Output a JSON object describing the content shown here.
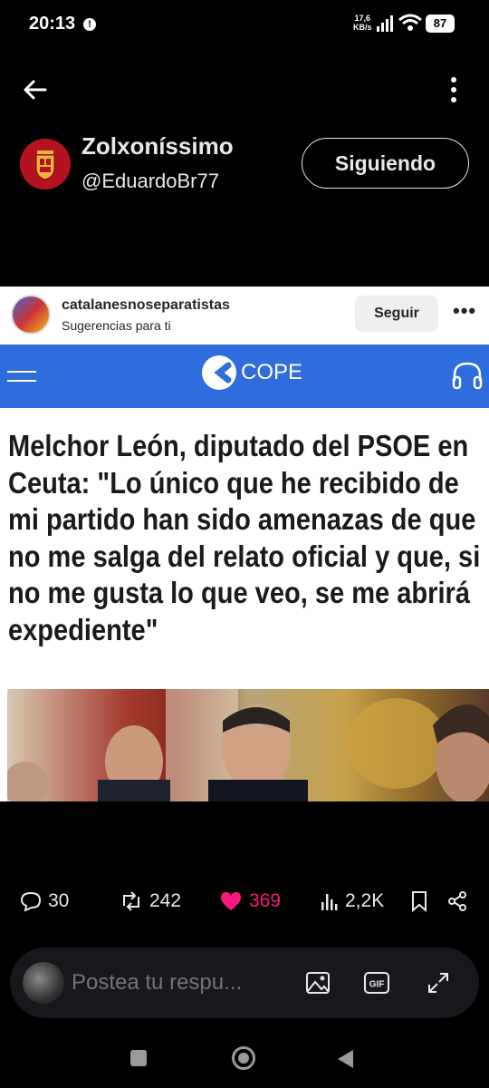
{
  "status_bar": {
    "time": "20:13",
    "alert_icon": "!",
    "speed_value": "17,6",
    "speed_unit": "KB/s",
    "battery": "87"
  },
  "header": {
    "display_name": "Zolxoníssimo",
    "handle": "@EduardoBr77",
    "follow_label": "Siguiendo"
  },
  "embedded_card": {
    "username": "catalanesnoseparatistas",
    "subtitle": "Sugerencias para ti",
    "follow_label": "Seguir",
    "more_label": "•••",
    "brand": "COPE",
    "brand_color": "#2f6cdc",
    "headline": "Melchor León, diputado del PSOE en Ceuta: \"Lo único que he recibido de mi partido han sido amenazas de que no me salga del relato oficial y que, si no me gusta lo que veo, se me abrirá expediente\""
  },
  "actions": {
    "replies": "30",
    "reposts": "242",
    "likes": "369",
    "views": "2,2K",
    "like_color": "#f91880"
  },
  "reply": {
    "placeholder": "Postea tu respu..."
  }
}
